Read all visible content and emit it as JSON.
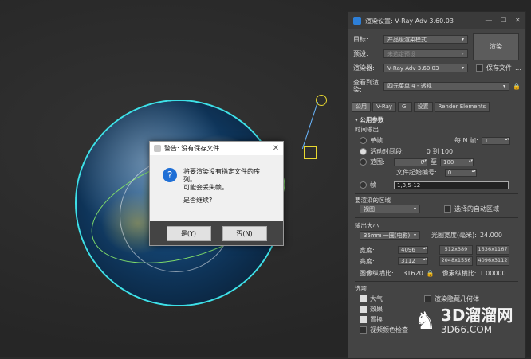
{
  "warning_dialog": {
    "title": "警告: 没有保存文件",
    "line1": "将要渲染没有指定文件的序列。",
    "line2": "可能会丢失帧。",
    "question": "是否继续?",
    "yes_label": "是(Y)",
    "no_label": "否(N)"
  },
  "panel": {
    "title": "渲染设置: V-Ray Adv 3.60.03",
    "target_label": "目标:",
    "target_value": "产品级渲染模式",
    "preset_label": "预设:",
    "preset_value": "未选定预设",
    "renderer_label": "渲染器:",
    "renderer_value": "V-Ray Adv 3.60.03",
    "save_file_label": "保存文件",
    "render_button": "渲染",
    "view_label": "查看到渲染:",
    "view_value": "四元菜单 4 - 透视",
    "tabs": [
      "公用",
      "V-Ray",
      "GI",
      "设置",
      "Render Elements"
    ],
    "common_params": "公用参数",
    "time_output": "时间输出",
    "single": "单帧",
    "every_n_label": "每 N 帧:",
    "every_n_value": "1",
    "active_segment": "活动时间段:",
    "active_range": "0 到 100",
    "range": "范围:",
    "range_from": "0",
    "range_to_label": "至",
    "range_to": "100",
    "file_start_label": "文件起始编号:",
    "file_start_value": "0",
    "frames_label": "帧",
    "frames_value": "1,3,5-12",
    "area_label": "要渲染的区域",
    "area_value": "视图",
    "auto_region": "选择的自动区域",
    "output_size": "输出大小",
    "film_value": "35mm 一圈(电影)",
    "aperture_label": "光圈宽度(毫米):",
    "aperture_value": "24.000",
    "width_label": "宽度:",
    "width_value": "4096",
    "height_label": "高度:",
    "height_value": "3112",
    "presets": [
      "512x389",
      "1536x1167",
      "2048x1556",
      "4096x3112"
    ],
    "image_aspect_label": "图像纵横比:",
    "image_aspect_value": "1.31620",
    "pixel_aspect_label": "像素纵横比:",
    "pixel_aspect_value": "1.00000",
    "options": "选项",
    "atmosphere": "大气",
    "effects": "效果",
    "displacement": "置换",
    "hidden_geo": "渲染隐藏几何体",
    "video_color": "视频颜色检查"
  },
  "watermark": {
    "brand": "3D溜溜网",
    "url": "3D66.COM"
  }
}
